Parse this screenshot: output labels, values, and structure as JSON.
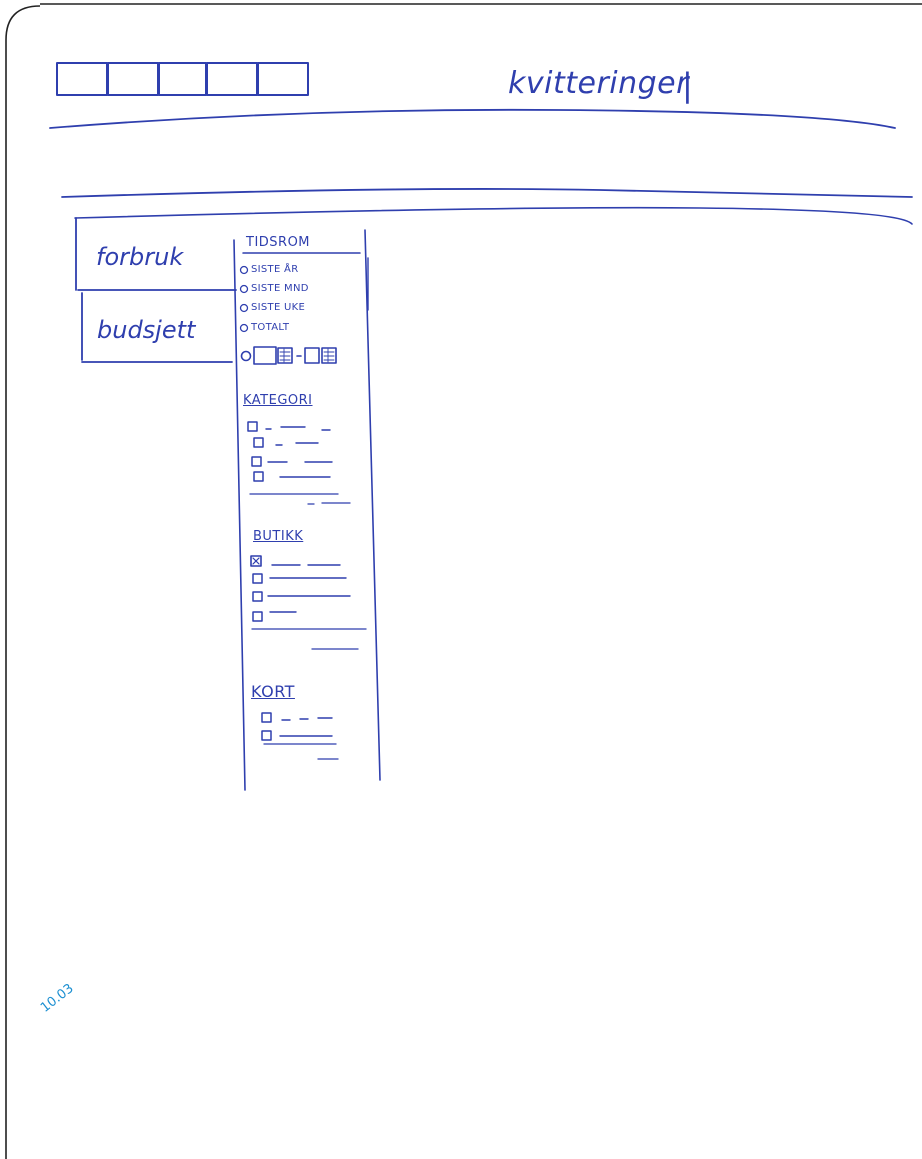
{
  "header": {
    "title": "kvitteringer",
    "toolbar_buttons": [
      "box",
      "box",
      "box",
      "box",
      "box"
    ]
  },
  "sidebar": {
    "items": [
      {
        "label": "forbruk"
      },
      {
        "label": "budsjett"
      }
    ]
  },
  "filters": {
    "tidsrom": {
      "heading": "TIDSROM",
      "options": [
        "SISTE ÅR",
        "SISTE MND",
        "SISTE UKE",
        "TOTALT"
      ]
    },
    "kategori": {
      "heading": "KATEGORI",
      "item_count": 4
    },
    "butikk": {
      "heading": "BUTIKK",
      "item_count": 4
    },
    "kort": {
      "heading": "KORT",
      "item_count": 2
    }
  },
  "annotation": {
    "text": "10.03"
  },
  "colors": {
    "ink": "#2f3fae",
    "note": "#1b8fd1",
    "frame": "#222222"
  }
}
